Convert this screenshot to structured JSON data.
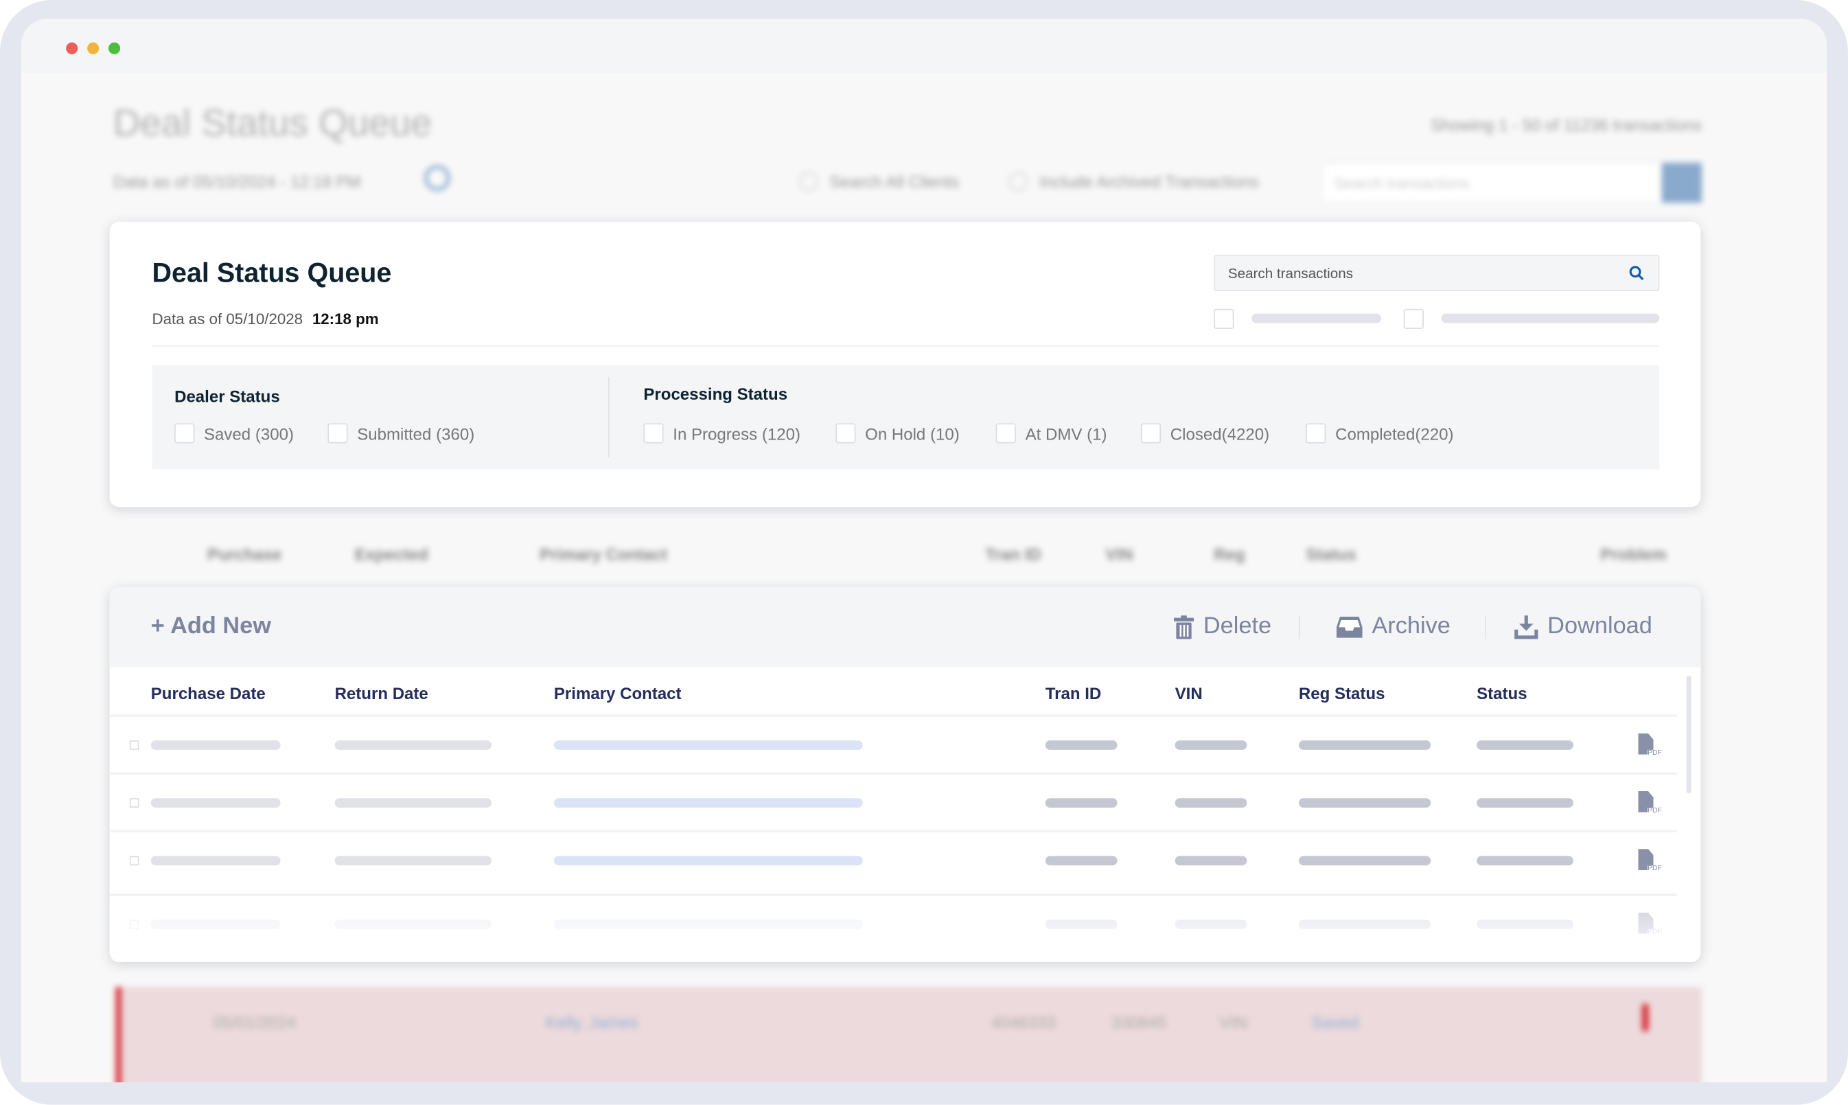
{
  "window": {
    "controls": {
      "close_color": "#ec5f57",
      "minimize_color": "#f0b53a",
      "maximize_color": "#4dbd3f"
    }
  },
  "background": {
    "title": "Deal Status Queue",
    "data_as_of": "Data as of 05/10/2024 - 12:18 PM",
    "showing": "Showing 1 - 50 of 11236 transactions",
    "search_all_clients": "Search All Clients",
    "include_archived": "Include Archived Transactions",
    "search_placeholder": "Search transactions",
    "columns": [
      "Purchase",
      "Expected",
      "Primary Contact",
      "Tran ID",
      "VIN",
      "Reg",
      "Status",
      "Problem"
    ],
    "highlighted_row": {
      "date": "05/01/2024",
      "contact": "Kelly, James",
      "tran_id": "4046333",
      "vin": "330845",
      "reg": "VIN",
      "status": "Saved"
    }
  },
  "header_card": {
    "title": "Deal Status Queue",
    "data_as_of_label": "Data as of 05/10/2028",
    "time": "12:18 pm",
    "search_placeholder": "Search transactions",
    "dealer_status": {
      "label": "Dealer Status",
      "options": [
        "Saved (300)",
        "Submitted (360)"
      ]
    },
    "processing_status": {
      "label": "Processing Status",
      "options": [
        "In Progress (120)",
        "On Hold (10)",
        "At DMV (1)",
        "Closed(4220)",
        "Completed(220)"
      ]
    }
  },
  "table_card": {
    "add_new": "+ Add New",
    "delete": "Delete",
    "archive": "Archive",
    "download": "Download",
    "columns": [
      "Purchase Date",
      "Return Date",
      "Primary Contact",
      "Tran ID",
      "VIN",
      "Reg Status",
      "Status"
    ],
    "row_icon": "pdf-file-icon",
    "pdf_label": "PDF"
  },
  "colors": {
    "accent": "#0b5cab",
    "heading": "#252d5c",
    "problem": "#d9363e"
  }
}
